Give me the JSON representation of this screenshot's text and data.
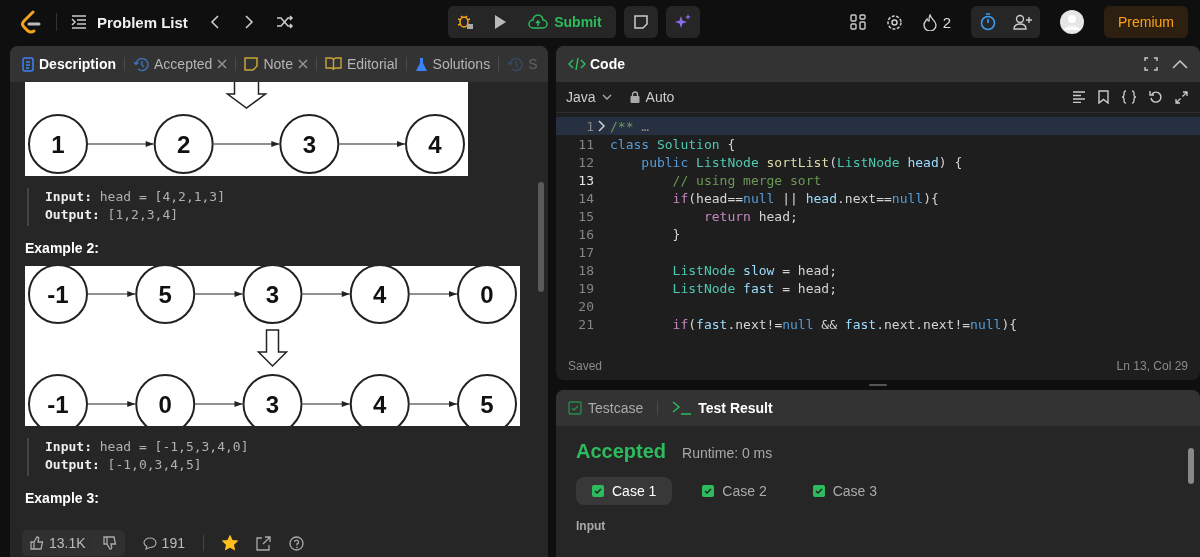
{
  "topbar": {
    "problem_list": "Problem List",
    "submit": "Submit",
    "streak": "2",
    "premium": "Premium"
  },
  "description_tabs": [
    {
      "label": "Description",
      "kind": "doc",
      "selected": true,
      "closable": false
    },
    {
      "label": "Accepted",
      "kind": "history",
      "selected": false,
      "closable": true
    },
    {
      "label": "Note",
      "kind": "note",
      "selected": false,
      "closable": true
    },
    {
      "label": "Editorial",
      "kind": "book",
      "selected": false,
      "closable": false
    },
    {
      "label": "Solutions",
      "kind": "flask",
      "selected": false,
      "closable": false
    },
    {
      "label": "S",
      "kind": "history",
      "selected": false,
      "closable": false
    }
  ],
  "blocks": [
    {
      "kind": "diagram",
      "arrow_above": true,
      "rows": [
        [
          "1",
          "2",
          "3",
          "4"
        ]
      ]
    },
    {
      "kind": "io",
      "input_label": "Input:",
      "input": "head = [4,2,1,3]",
      "output_label": "Output:",
      "output": "[1,2,3,4]"
    },
    {
      "kind": "heading",
      "text": "Example 2:"
    },
    {
      "kind": "diagram",
      "arrow_above": false,
      "rows": [
        [
          "-1",
          "5",
          "3",
          "4",
          "0"
        ],
        [
          "-1",
          "0",
          "3",
          "4",
          "5"
        ]
      ]
    },
    {
      "kind": "io",
      "input_label": "Input:",
      "input": "head = [-1,5,3,4,0]",
      "output_label": "Output:",
      "output": "[-1,0,3,4,5]"
    },
    {
      "kind": "heading",
      "text": "Example 3:"
    }
  ],
  "footer": {
    "likes": "13.1K",
    "comments": "191",
    "favorited": true
  },
  "code": {
    "title": "Code",
    "language": "Java",
    "mode": "Auto",
    "status": "Saved",
    "cursor": "Ln 13, Col 29",
    "lines": [
      {
        "num": "1",
        "folded": true,
        "current": false,
        "tokens": [
          {
            "t": "/**",
            "kind": "comment"
          },
          {
            "t": " …",
            "kind": "fold"
          }
        ]
      },
      {
        "num": "11",
        "folded": false,
        "current": false,
        "tokens": [
          {
            "t": "class ",
            "color": "#569cd6"
          },
          {
            "t": "Solution",
            "color": "#4ec9b0"
          },
          {
            "t": " {",
            "color": "#d4d4d4"
          }
        ]
      },
      {
        "num": "12",
        "folded": false,
        "current": false,
        "tokens": [
          {
            "t": "    public ",
            "color": "#569cd6"
          },
          {
            "t": "ListNode ",
            "color": "#4ec9b0"
          },
          {
            "t": "sortList",
            "color": "#dcdcaa"
          },
          {
            "t": "(",
            "color": "#d4d4d4"
          },
          {
            "t": "ListNode ",
            "color": "#4ec9b0"
          },
          {
            "t": "head",
            "color": "#9cdcfe"
          },
          {
            "t": ") {",
            "color": "#d4d4d4"
          }
        ]
      },
      {
        "num": "13",
        "folded": false,
        "current": true,
        "tokens": [
          {
            "t": "        // using merge sort",
            "color": "#6a9955"
          }
        ]
      },
      {
        "num": "14",
        "folded": false,
        "current": false,
        "tokens": [
          {
            "t": "        if",
            "color": "#c586c0"
          },
          {
            "t": "(head==",
            "color": "#d4d4d4"
          },
          {
            "t": "null",
            "color": "#569cd6"
          },
          {
            "t": " || ",
            "kind": "plain"
          },
          {
            "t": "head",
            "color": "#9cdcfe"
          },
          {
            "t": ".next==",
            "color": "#d4d4d4"
          },
          {
            "t": "null",
            "color": "#569cd6"
          },
          {
            "t": "){",
            "color": "#d4d4d4"
          }
        ]
      },
      {
        "num": "15",
        "folded": false,
        "current": false,
        "tokens": [
          {
            "t": "            return ",
            "color": "#c586c0"
          },
          {
            "t": "head;",
            "color": "#d4d4d4"
          }
        ]
      },
      {
        "num": "16",
        "folded": false,
        "current": false,
        "tokens": [
          {
            "t": "        }",
            "color": "#d4d4d4"
          }
        ]
      },
      {
        "num": "17",
        "folded": false,
        "current": false
      },
      {
        "num": "18",
        "folded": false,
        "current": false,
        "tokens": [
          {
            "t": "        ListNode ",
            "color": "#4ec9b0"
          },
          {
            "t": "slow",
            "color": "#9cdcfe"
          },
          {
            "t": " = head;",
            "color": "#d4d4d4"
          }
        ]
      },
      {
        "num": "19",
        "folded": false,
        "current": false,
        "tokens": [
          {
            "t": "        ListNode ",
            "color": "#4ec9b0"
          },
          {
            "t": "fast",
            "color": "#9cdcfe"
          },
          {
            "t": " = head;",
            "color": "#d4d4d4"
          }
        ]
      },
      {
        "num": "20",
        "folded": false,
        "current": false
      },
      {
        "num": "21",
        "folded": false,
        "current": false,
        "tokens": [
          {
            "t": "        if",
            "color": "#c586c0"
          },
          {
            "t": "(",
            "color": "#d4d4d4"
          },
          {
            "t": "fast",
            "color": "#9cdcfe"
          },
          {
            "t": ".next!=",
            "color": "#d4d4d4"
          },
          {
            "t": "null",
            "color": "#569cd6"
          },
          {
            "t": " && ",
            "color": "#d4d4d4"
          },
          {
            "t": "fast",
            "color": "#9cdcfe"
          },
          {
            "t": ".next.next!=",
            "color": "#d4d4d4"
          },
          {
            "t": "null",
            "color": "#569cd6"
          },
          {
            "t": "){",
            "color": "#d4d4d4"
          }
        ]
      }
    ]
  },
  "result_tabs": [
    {
      "label": "Testcase",
      "selected": false
    },
    {
      "label": "Test Result",
      "selected": true
    }
  ],
  "result": {
    "verdict": "Accepted",
    "runtime": "Runtime: 0 ms",
    "input_label": "Input",
    "cases": [
      {
        "label": "Case 1",
        "selected": true,
        "passed": true
      },
      {
        "label": "Case 2",
        "selected": false,
        "passed": true
      },
      {
        "label": "Case 3",
        "selected": false,
        "passed": true
      }
    ]
  }
}
